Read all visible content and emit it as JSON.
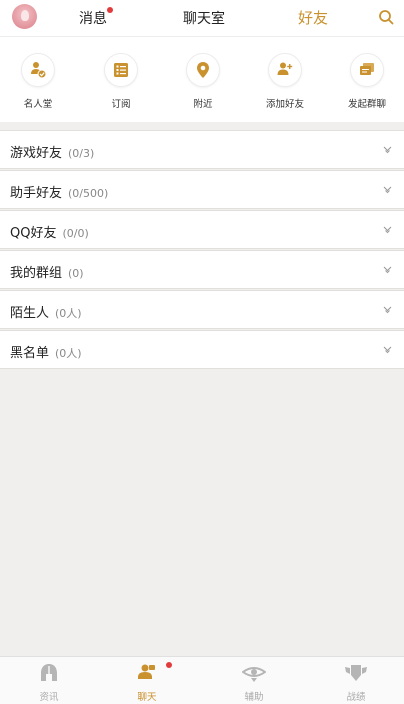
{
  "header": {
    "tabs": [
      {
        "label": "消息",
        "active": false,
        "badge": true
      },
      {
        "label": "聊天室",
        "active": false,
        "badge": false
      },
      {
        "label": "好友",
        "active": true,
        "badge": false
      }
    ]
  },
  "actions": [
    {
      "label": "名人堂",
      "icon": "hall-of-fame-icon"
    },
    {
      "label": "订阅",
      "icon": "subscribe-icon"
    },
    {
      "label": "附近",
      "icon": "location-pin-icon"
    },
    {
      "label": "添加好友",
      "icon": "add-friend-icon"
    },
    {
      "label": "发起群聊",
      "icon": "group-chat-icon"
    }
  ],
  "groups": [
    {
      "name": "游戏好友",
      "count": "(0/3)"
    },
    {
      "name": "助手好友",
      "count": "(0/500)"
    },
    {
      "name": "QQ好友",
      "count": "(0/0)"
    },
    {
      "name": "我的群组",
      "count": "(0)"
    },
    {
      "name": "陌生人",
      "count": "(0人)"
    },
    {
      "name": "黑名单",
      "count": "(0人)"
    }
  ],
  "bottom_nav": [
    {
      "label": "资讯",
      "active": false,
      "badge": false
    },
    {
      "label": "聊天",
      "active": true,
      "badge": true
    },
    {
      "label": "辅助",
      "active": false,
      "badge": false
    },
    {
      "label": "战绩",
      "active": false,
      "badge": false
    }
  ],
  "colors": {
    "accent": "#c9922f",
    "badge": "#e23b3b",
    "background": "#f0efed"
  }
}
